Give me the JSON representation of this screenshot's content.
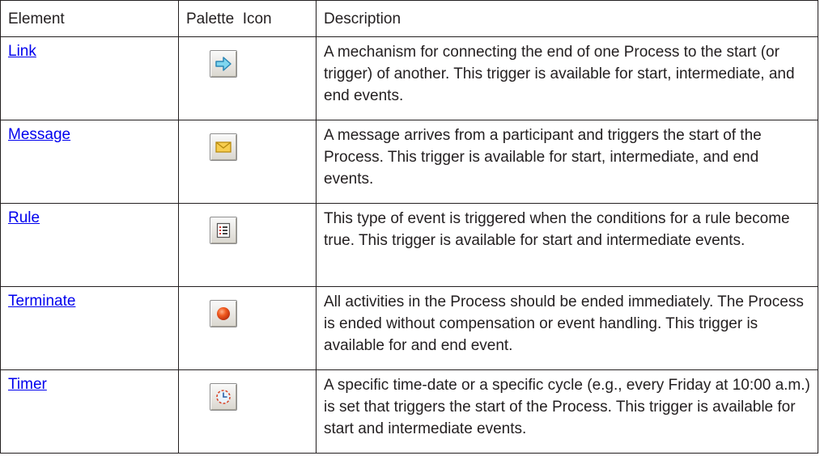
{
  "columns": {
    "element": "Element",
    "palette_icon": "Palette  Icon",
    "description": "Description"
  },
  "rows": [
    {
      "element": "Link",
      "icon": "link-arrow-icon",
      "description": "A mechanism for connecting the end of one Process to the start (or trigger) of another. This trigger is available for start, intermediate, and end events."
    },
    {
      "element": "Message",
      "icon": "message-envelope-icon",
      "description": "A message arrives from a participant and triggers the start of the Process. This trigger is available for start, intermediate, and end events."
    },
    {
      "element": "Rule",
      "icon": "rule-list-icon",
      "description": "This type of event is triggered when the conditions for a rule become true. This trigger is available for start and intermediate events."
    },
    {
      "element": "Terminate",
      "icon": "terminate-circle-icon",
      "description": "All activities in the Process should be ended immediately. The Process is ended without compensation or event handling. This trigger is available for and end event."
    },
    {
      "element": "Timer",
      "icon": "timer-clock-icon",
      "description": "A specific time-date or a specific cycle (e.g., every Friday at 10:00 a.m.) is set that triggers the start of the Process. This trigger is available for start and intermediate events."
    }
  ],
  "colors": {
    "link": "#0000ee",
    "border": "#231f20",
    "text": "#231f20"
  }
}
